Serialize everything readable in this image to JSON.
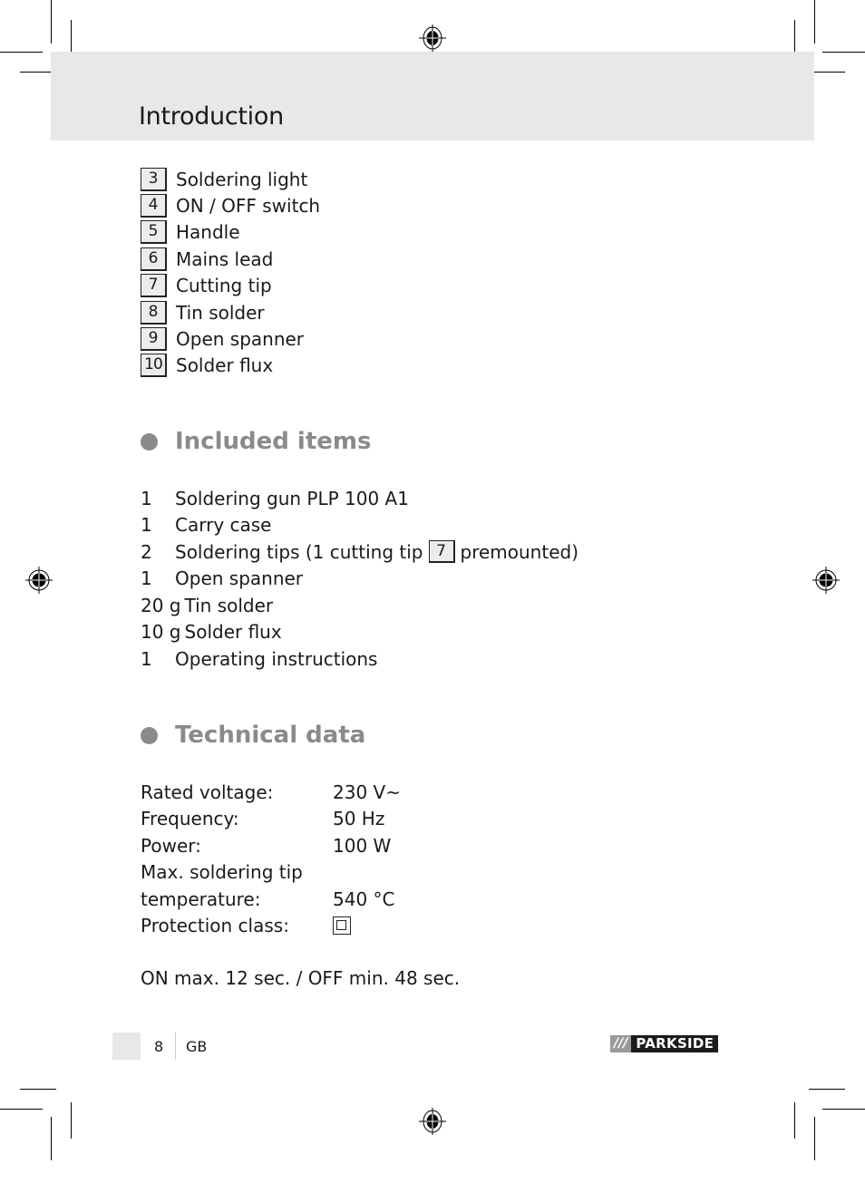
{
  "header": {
    "title": "Introduction"
  },
  "parts": [
    {
      "num": "3",
      "label": "Soldering light"
    },
    {
      "num": "4",
      "label": "ON / OFF switch"
    },
    {
      "num": "5",
      "label": "Handle"
    },
    {
      "num": "6",
      "label": "Mains lead"
    },
    {
      "num": "7",
      "label": "Cutting tip"
    },
    {
      "num": "8",
      "label": "Tin solder"
    },
    {
      "num": "9",
      "label": "Open spanner"
    },
    {
      "num": "10",
      "label": "Solder flux"
    }
  ],
  "included_items": {
    "heading": "Included items",
    "items": [
      {
        "qty": "1",
        "label": "Soldering gun PLP 100 A1"
      },
      {
        "qty": "1",
        "label": "Carry case"
      },
      {
        "qty": "2",
        "label_before": "Soldering tips (1 cutting tip",
        "ref": "7",
        "label_after": "premounted)"
      },
      {
        "qty": "1",
        "label": "Open spanner"
      },
      {
        "qty": "20 g",
        "label": "Tin solder"
      },
      {
        "qty": "10 g",
        "label": "Solder flux"
      },
      {
        "qty": "1",
        "label": "Operating instructions"
      }
    ]
  },
  "technical_data": {
    "heading": "Technical data",
    "rows": [
      {
        "label": "Rated voltage:",
        "value": "230 V~"
      },
      {
        "label": "Frequency:",
        "value": "50 Hz"
      },
      {
        "label": "Power:",
        "value": "100 W"
      },
      {
        "label": "Max. soldering tip",
        "value": ""
      },
      {
        "label": "temperature:",
        "value": "540 °C"
      },
      {
        "label": "Protection class:",
        "value": "",
        "icon": "protection-class-ii-icon"
      }
    ],
    "duty_cycle": "ON max. 12 sec. / OFF min. 48 sec."
  },
  "footer": {
    "page_number": "8",
    "language": "GB",
    "brand_slashes": "///",
    "brand": "PARKSIDE"
  }
}
